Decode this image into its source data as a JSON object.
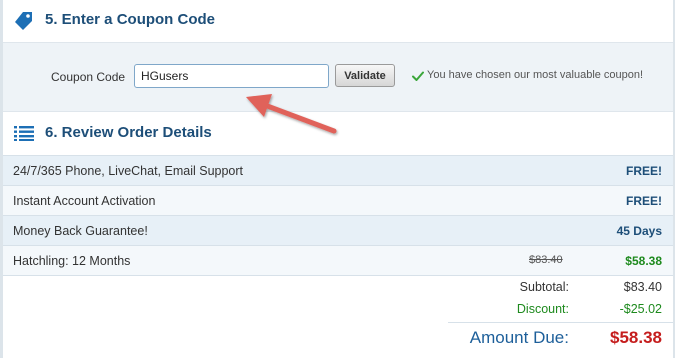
{
  "section5": {
    "title": "5. Enter a Coupon Code",
    "icon": "tag-icon",
    "coupon_label": "Coupon Code",
    "coupon_value": "HGusers",
    "validate_label": "Validate",
    "message": "You have chosen our most valuable coupon!"
  },
  "section6": {
    "title": "6. Review Order Details",
    "icon": "list-icon",
    "rows": [
      {
        "label": "24/7/365 Phone, LiveChat, Email Support",
        "original": "",
        "value": "FREE!"
      },
      {
        "label": "Instant Account Activation",
        "original": "",
        "value": "FREE!"
      },
      {
        "label": "Money Back Guarantee!",
        "original": "",
        "value": "45 Days"
      },
      {
        "label": "Hatchling: 12 Months",
        "original": "$83.40",
        "value": "$58.38"
      }
    ]
  },
  "totals": {
    "subtotal_label": "Subtotal:",
    "subtotal_value": "$83.40",
    "discount_label": "Discount:",
    "discount_value": "-$25.02",
    "due_label": "Amount Due:",
    "due_value": "$58.38"
  },
  "colors": {
    "heading": "#1d4e78",
    "accent_green": "#1e8a1e",
    "amount_due": "#c51d1d",
    "annotation_arrow": "#e0625a"
  }
}
